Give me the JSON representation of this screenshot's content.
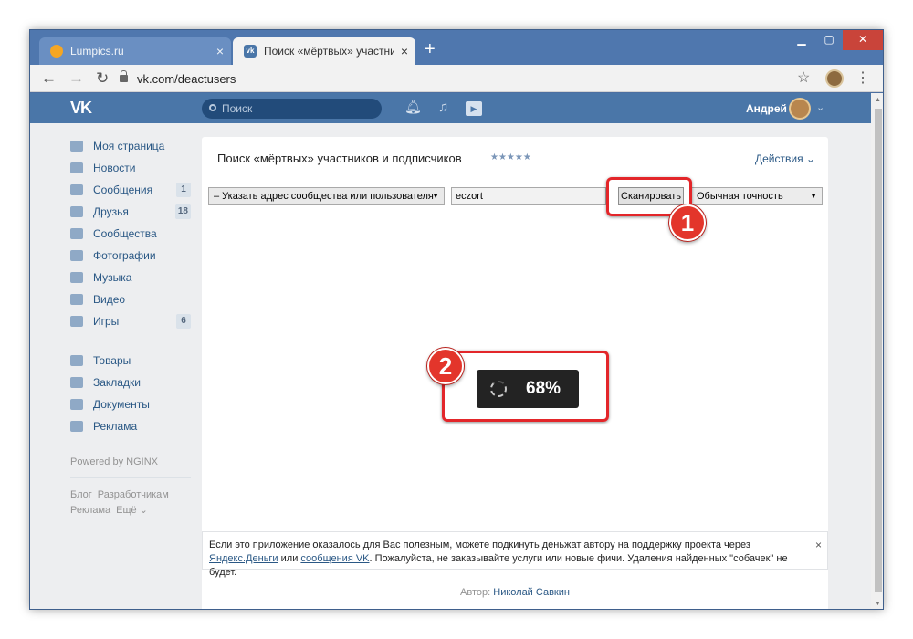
{
  "browser": {
    "tabs": [
      {
        "title": "Lumpics.ru",
        "close": "×"
      },
      {
        "title": "Поиск «мёртвых» участников и",
        "close": "×"
      }
    ],
    "new_tab": "+",
    "url": "vk.com/deactusers"
  },
  "vk_header": {
    "logo": "VK",
    "search_placeholder": "Поиск",
    "user_name": "Андрей"
  },
  "sidebar": {
    "items": [
      {
        "label": "Моя страница",
        "badge": ""
      },
      {
        "label": "Новости",
        "badge": ""
      },
      {
        "label": "Сообщения",
        "badge": "1"
      },
      {
        "label": "Друзья",
        "badge": "18"
      },
      {
        "label": "Сообщества",
        "badge": ""
      },
      {
        "label": "Фотографии",
        "badge": ""
      },
      {
        "label": "Музыка",
        "badge": ""
      },
      {
        "label": "Видео",
        "badge": ""
      },
      {
        "label": "Игры",
        "badge": "6"
      }
    ],
    "items2": [
      {
        "label": "Товары"
      },
      {
        "label": "Закладки"
      },
      {
        "label": "Документы"
      },
      {
        "label": "Реклама"
      }
    ],
    "powered": "Powered by NGINX",
    "footer_links": [
      "Блог",
      "Разработчикам",
      "Реклама",
      "Ещё ⌄"
    ]
  },
  "app": {
    "title": "Поиск «мёртвых» участников и подписчиков",
    "stars": "★★★★★",
    "actions": "Действия ⌄",
    "target_select": "– Указать адрес сообщества или пользователя",
    "target_input": "eczort",
    "scan_button": "Сканировать",
    "accuracy_select": "Обычная точность",
    "progress": "68%",
    "progress_value": 0.68,
    "notice": {
      "text1": "Если это приложение оказалось для Вас полезным, можете подкинуть деньжат автору на поддержку проекта через",
      "link1": "Яндекс.Деньги",
      "or": " или ",
      "link2": "сообщения VK",
      "text2": ". Пожалуйста, не заказывайте услуги или новые фичи. Удаления найденных \"собачек\" не будет.",
      "close": "×"
    },
    "author_label": "Автор:",
    "author_name": "Николай Савкин"
  },
  "annotations": {
    "marker1": "1",
    "marker2": "2",
    "color": "#e3262a"
  }
}
